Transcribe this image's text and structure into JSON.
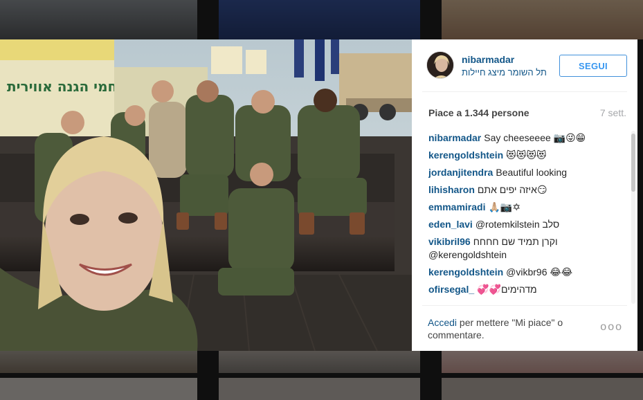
{
  "post": {
    "username": "nibarmadar",
    "location": "תל השומר מיצג חיילות",
    "follow_label": "SEGUI",
    "likes": "Piace a 1.344 persone",
    "time": "7 sett."
  },
  "comments": [
    {
      "user": "nibarmadar",
      "text": "Say cheeseeee 📷😜😁"
    },
    {
      "user": "kerengoldshtein",
      "text": "😻😻😻😻"
    },
    {
      "user": "jordanjitendra",
      "text": "Beautiful looking"
    },
    {
      "user": "lihisharon",
      "text": "איזה יפים אתם😏"
    },
    {
      "user": "emmamiradi",
      "text": "🙏🏼📷✡"
    },
    {
      "user": "eden_lavi",
      "text": "@rotemkilstein סלב"
    },
    {
      "user": "vikibril96",
      "text": "וקרן תמיד שם חחחח @kerengoldshtein"
    },
    {
      "user": "kerengoldshtein",
      "text": "@vikbr96 😂😂"
    },
    {
      "user": "ofirsegal_",
      "text": "💞💞מדהימים"
    }
  ],
  "footer": {
    "login_link": "Accedi",
    "login_text": " per mettere \"Mi piace\" o commentare.",
    "more": "ooo"
  }
}
